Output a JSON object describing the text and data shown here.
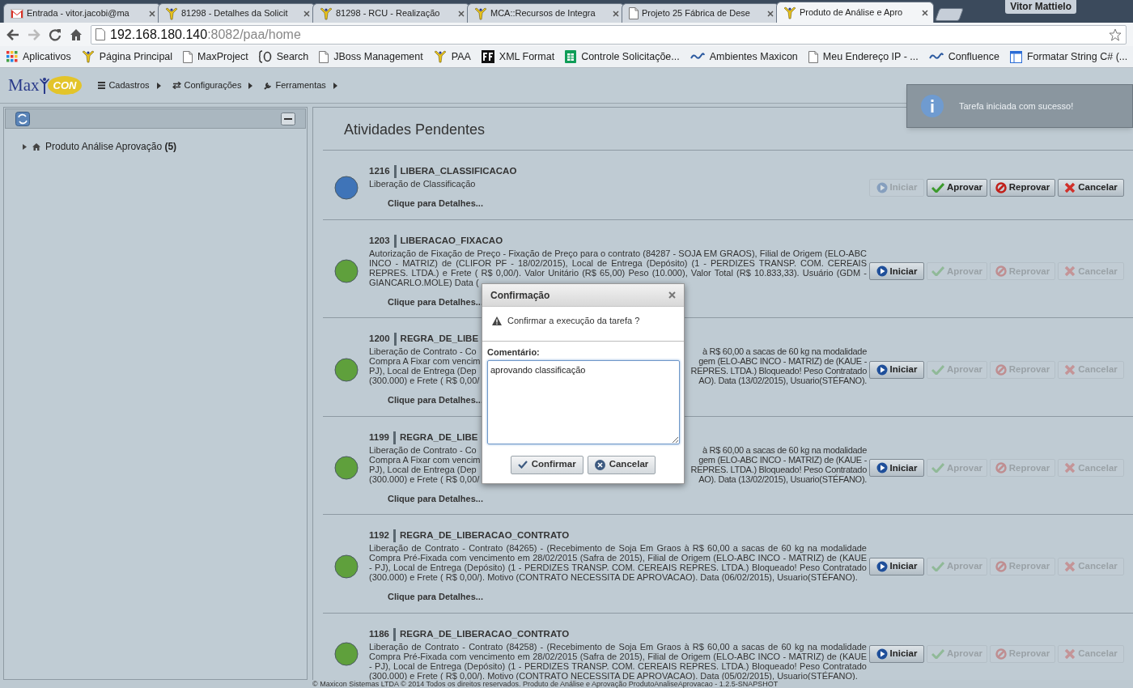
{
  "browser": {
    "tabs": [
      {
        "title": "Entrada - vitor.jacobi@ma",
        "kind": "mail",
        "selected": false
      },
      {
        "title": "81298 - Detalhes da Solicit",
        "kind": "maxicon",
        "selected": false
      },
      {
        "title": "81298 - RCU - Realização",
        "kind": "maxicon",
        "selected": false
      },
      {
        "title": "MCA::Recursos de Integra",
        "kind": "maxicon",
        "selected": false
      },
      {
        "title": "Projeto 25 Fábrica de Dese",
        "kind": "page",
        "selected": false
      },
      {
        "title": "Produto de Análise e Apro",
        "kind": "maxicon",
        "selected": true
      }
    ],
    "profile": "Vitor Mattielo",
    "url_host": "192.168.180.140",
    "url_rest": ":8082/paa/home",
    "bookmarks": [
      {
        "label": "Aplicativos",
        "kind": "apps"
      },
      {
        "label": "Página Principal",
        "kind": "maxicon"
      },
      {
        "label": "MaxProject",
        "kind": "page"
      },
      {
        "label": "Search",
        "kind": "braces"
      },
      {
        "label": "JBoss Management",
        "kind": "page"
      },
      {
        "label": "PAA",
        "kind": "maxicon"
      },
      {
        "label": "XML Format",
        "kind": "black"
      },
      {
        "label": "Controle Solicitaçõe...",
        "kind": "sheet"
      },
      {
        "label": "Ambientes Maxicon",
        "kind": "wave"
      },
      {
        "label": "Meu Endereço IP - ...",
        "kind": "page"
      },
      {
        "label": "Confluence",
        "kind": "wave"
      },
      {
        "label": "Formatar String C# (...",
        "kind": "window"
      }
    ]
  },
  "app": {
    "logo": {
      "left": "Max",
      "right": "CON"
    },
    "menu": [
      {
        "label": "Cadastros",
        "kind": "list"
      },
      {
        "label": "Configurações",
        "kind": "arrows"
      },
      {
        "label": "Ferramentas",
        "kind": "wrench"
      }
    ],
    "tree": [
      {
        "label": "Produto Análise Aprovação **(5)**",
        "expanded": false
      }
    ],
    "heading": "Atividades Pendentes",
    "activities": [
      {
        "id": "1216",
        "name": "LIBERA_CLASSIFICACAO",
        "color": "#3f74b8",
        "description": "Liberação de Classificação",
        "details": "Clique para Detalhes...",
        "buttons": [
          {
            "label": "Iniciar",
            "kind": "start",
            "disabled": true
          },
          {
            "label": "Aprovar",
            "kind": "approve",
            "disabled": false
          },
          {
            "label": "Reprovar",
            "kind": "reject",
            "disabled": false
          },
          {
            "label": "Cancelar",
            "kind": "cancel",
            "disabled": false
          }
        ]
      },
      {
        "id": "1203",
        "name": "LIBERACAO_FIXACAO",
        "color": "#5fa03c",
        "description_lines": [
          {
            "left": "Autorização de Fixação de Preço - Fixação de Preço para o contrato (84287 - SOJA EM GRAOS), Filial de Origem (ELO-ABC"
          },
          {
            "left": "INCO - MATRIZ) de (CLIFOR PF - 18/02/2015), Local de Entrega (Depósito) (1 - PERDIZES TRANSP. COM. CEREAIS"
          },
          {
            "left": "REPRES. LTDA.) e Frete ( R$ 0,00/). Valor Unitário (R$ 65,00) Peso (10.000), Valor Total (R$ 10.833,33). Usuário (GDM -"
          },
          {
            "left": "GIANCARLO.MOLE) Data ("
          }
        ],
        "details": "Clique para Detalhes...",
        "buttons": [
          {
            "label": "Iniciar",
            "kind": "start",
            "disabled": false
          },
          {
            "label": "Aprovar",
            "kind": "approve",
            "disabled": true
          },
          {
            "label": "Reprovar",
            "kind": "reject",
            "disabled": true
          },
          {
            "label": "Cancelar",
            "kind": "cancel",
            "disabled": true
          }
        ]
      },
      {
        "id": "1200",
        "name": "REGRA_DE_LIBE",
        "color": "#5fa03c",
        "description_lines": [
          {
            "left": "Liberação de Contrato - Co",
            "right": "à R$ 60,00 a sacas de 60 kg na modalidade"
          },
          {
            "left": "Compra A Fixar com vencim",
            "right": "gem (ELO-ABC INCO - MATRIZ) de (KAUE -"
          },
          {
            "left": "PJ), Local de Entrega (Dep",
            "right": "REPRES. LTDA.) Bloqueado! Peso Contratado"
          },
          {
            "left": "(300.000) e Frete ( R$ 0,00/",
            "right": "AO). Data (13/02/2015), Usuario(STÉFANO)."
          }
        ],
        "details": "Clique para Detalhes...",
        "buttons": [
          {
            "label": "Iniciar",
            "kind": "start",
            "disabled": false
          },
          {
            "label": "Aprovar",
            "kind": "approve",
            "disabled": true
          },
          {
            "label": "Reprovar",
            "kind": "reject",
            "disabled": true
          },
          {
            "label": "Cancelar",
            "kind": "cancel",
            "disabled": true
          }
        ]
      },
      {
        "id": "1199",
        "name": "REGRA_DE_LIBE",
        "color": "#5fa03c",
        "description_lines": [
          {
            "left": "Liberação de Contrato - Co",
            "right": "à R$ 60,00 a sacas de 60 kg na modalidade"
          },
          {
            "left": "Compra A Fixar com vencim",
            "right": "gem (ELO-ABC INCO - MATRIZ) de (KAUE -"
          },
          {
            "left": "PJ), Local de Entrega (Dep",
            "right": "REPRES. LTDA.) Bloqueado! Peso Contratado"
          },
          {
            "left": "(300.000) e Frete ( R$ 0,00/",
            "right": "AO). Data (13/02/2015), Usuario(STÉFANO)."
          }
        ],
        "details": "Clique para Detalhes...",
        "buttons": [
          {
            "label": "Iniciar",
            "kind": "start",
            "disabled": false
          },
          {
            "label": "Aprovar",
            "kind": "approve",
            "disabled": true
          },
          {
            "label": "Reprovar",
            "kind": "reject",
            "disabled": true
          },
          {
            "label": "Cancelar",
            "kind": "cancel",
            "disabled": true
          }
        ]
      },
      {
        "id": "1192",
        "name": "REGRA_DE_LIBERACAO_CONTRATO",
        "color": "#5fa03c",
        "description": "Liberação de Contrato - Contrato (84265) - (Recebimento de Soja Em Graos à R$ 60,00 a sacas de 60 kg na modalidade Compra Pré-Fixada com vencimento em 28/02/2015 (Safra de 2015), Filial de Origem (ELO-ABC INCO - MATRIZ) de (KAUE - PJ), Local de Entrega (Depósito) (1 - PERDIZES TRANSP. COM. CEREAIS REPRES. LTDA.) Bloqueado! Peso Contratado (300.000) e Frete ( R$ 0,00/). Motivo (CONTRATO NECESSITA DE APROVACAO). Data (06/02/2015), Usuario(STÉFANO).",
        "details": "Clique para Detalhes...",
        "buttons": [
          {
            "label": "Iniciar",
            "kind": "start",
            "disabled": false
          },
          {
            "label": "Aprovar",
            "kind": "approve",
            "disabled": true
          },
          {
            "label": "Reprovar",
            "kind": "reject",
            "disabled": true
          },
          {
            "label": "Cancelar",
            "kind": "cancel",
            "disabled": true
          }
        ]
      },
      {
        "id": "1186",
        "name": "REGRA_DE_LIBERACAO_CONTRATO",
        "color": "#5fa03c",
        "description": "Liberação de Contrato - Contrato (84258) - (Recebimento de Soja Em Graos à R$ 60,00 a sacas de 60 kg na modalidade Compra Pré-Fixada com vencimento em 28/02/2015 (Safra de 2015), Filial de Origem (ELO-ABC INCO - MATRIZ) de (KAUE - PJ), Local de Entrega (Depósito) (1 - PERDIZES TRANSP. COM. CEREAIS REPRES. LTDA.) Bloqueado! Peso Contratado (300.000) e Frete ( R$ 0,00/). Motivo (CONTRATO NECESSITA DE APROVACAO). Data (05/02/2015), Usuario(STÉFANO).",
        "buttons": [
          {
            "label": "Iniciar",
            "kind": "start",
            "disabled": false
          },
          {
            "label": "Aprovar",
            "kind": "approve",
            "disabled": true
          },
          {
            "label": "Reprovar",
            "kind": "reject",
            "disabled": true
          },
          {
            "label": "Cancelar",
            "kind": "cancel",
            "disabled": true
          }
        ]
      }
    ],
    "notification": "Tarefa iniciada com sucesso!",
    "dialog": {
      "title": "Confirmação",
      "message": "Confirmar a execução da tarefa ?",
      "comment_label": "Comentário:",
      "comment": "aprovando classificação",
      "buttons": [
        {
          "label": "Confirmar",
          "kind": "confirm"
        },
        {
          "label": "Cancelar",
          "kind": "cancel"
        }
      ]
    },
    "footer": "© Maxicon Sistemas LTDA © 2014 Todos os direitos reservados. Produto de Análise e Aprovação ProdutoAnaliseAprovacao - 1.2.5-SNAPSHOT"
  }
}
